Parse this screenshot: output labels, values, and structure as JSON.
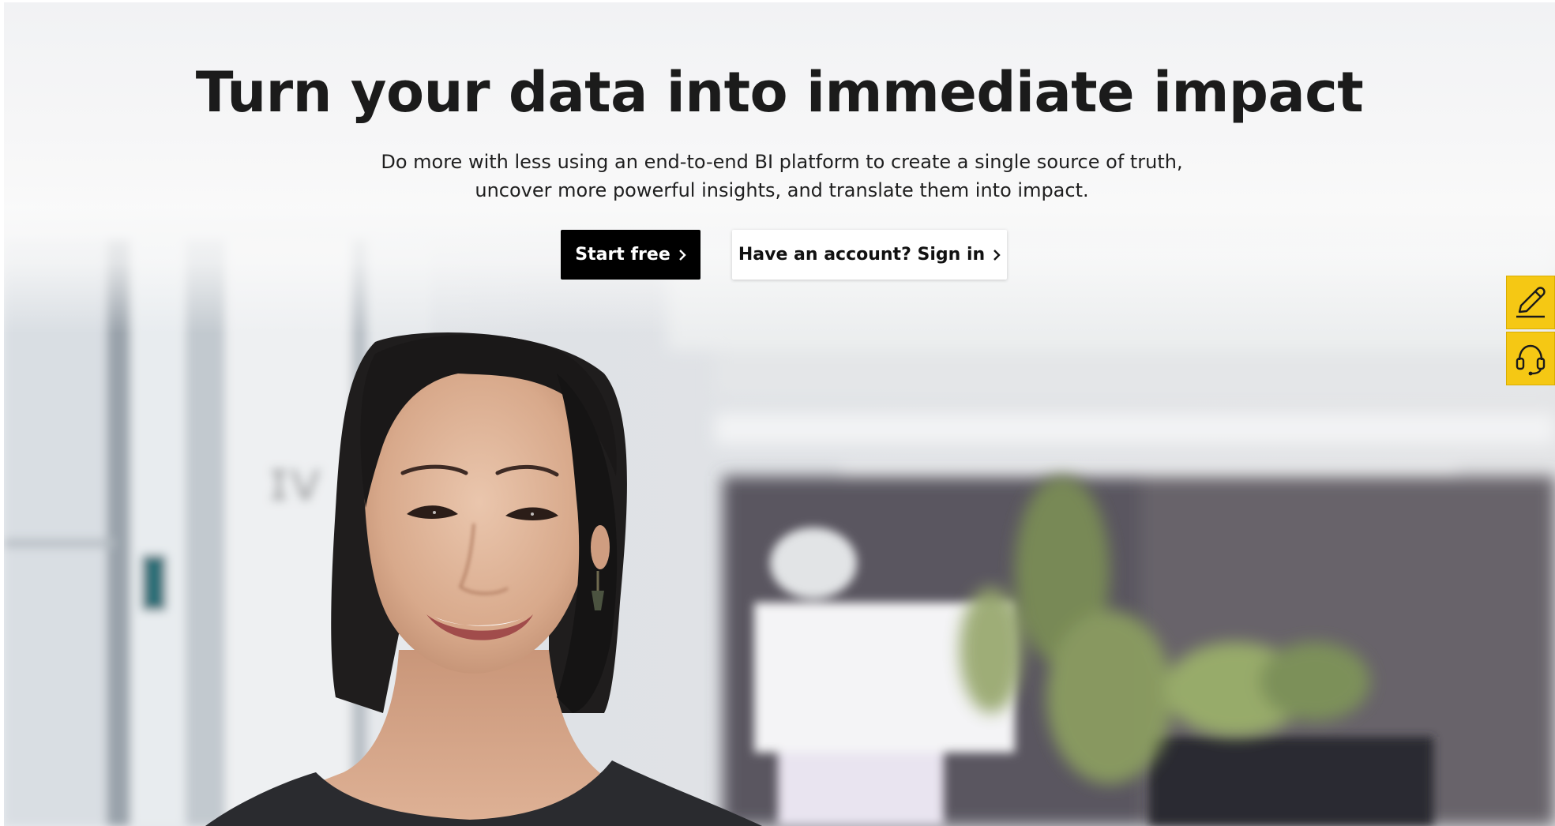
{
  "hero": {
    "title": "Turn your data into immediate impact",
    "subtitle": "Do more with less using an end-to-end BI platform to create a single source of truth, uncover more powerful insights, and translate them into impact."
  },
  "cta": {
    "primary_label": "Start free",
    "secondary_label": "Have an account? Sign in"
  },
  "side_widgets": [
    {
      "icon": "pencil-icon"
    },
    {
      "icon": "headset-icon"
    }
  ],
  "colors": {
    "primary_button": "#000000",
    "secondary_button": "#ffffff",
    "side_widget": "#f5c814",
    "title_text": "#1b1b1b"
  }
}
